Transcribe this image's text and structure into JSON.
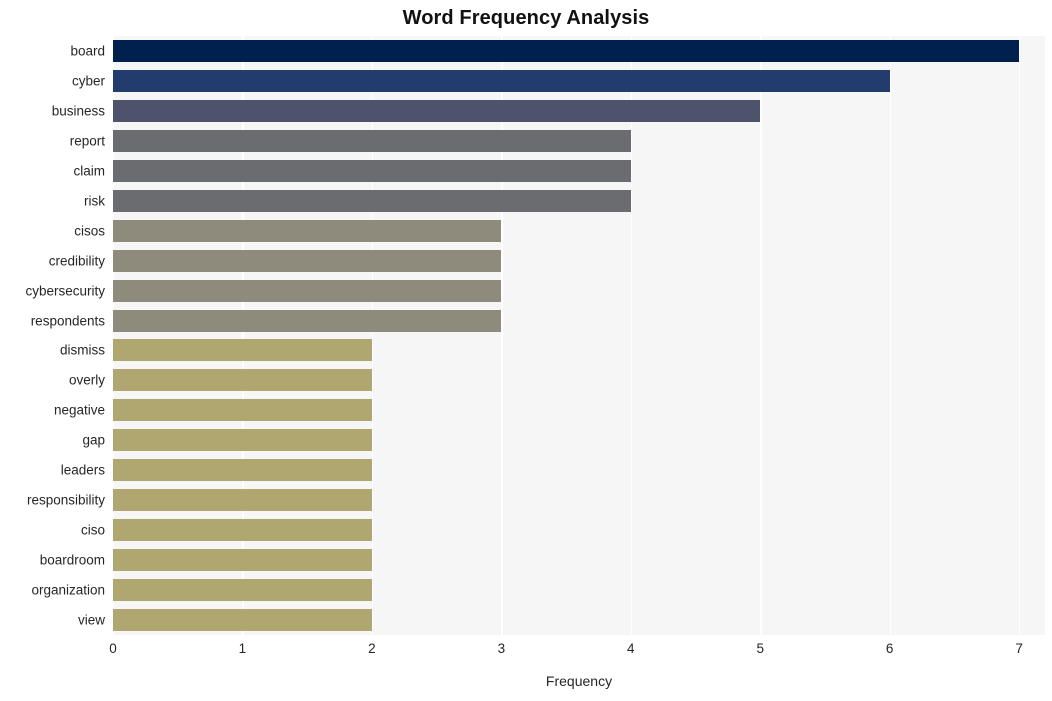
{
  "chart_data": {
    "type": "bar",
    "orientation": "horizontal",
    "title": "Word Frequency Analysis",
    "xlabel": "Frequency",
    "ylabel": "",
    "xlim": [
      0,
      7.2
    ],
    "xticks": [
      0,
      1,
      2,
      3,
      4,
      5,
      6,
      7
    ],
    "xtick_labels": [
      "0",
      "1",
      "2",
      "3",
      "4",
      "5",
      "6",
      "7"
    ],
    "grid": true,
    "grid_axis": "x",
    "legend": null,
    "categories": [
      "board",
      "cyber",
      "business",
      "report",
      "claim",
      "risk",
      "cisos",
      "credibility",
      "cybersecurity",
      "respondents",
      "dismiss",
      "overly",
      "negative",
      "gap",
      "leaders",
      "responsibility",
      "ciso",
      "boardroom",
      "organization",
      "view"
    ],
    "values": [
      7,
      6,
      5,
      4,
      4,
      4,
      3,
      3,
      3,
      3,
      2,
      2,
      2,
      2,
      2,
      2,
      2,
      2,
      2,
      2
    ],
    "bar_colors": [
      "#00214d",
      "#233c6e",
      "#4d536b",
      "#6b6c70",
      "#6b6c70",
      "#6b6c70",
      "#8e8b7c",
      "#8e8b7c",
      "#8e8b7c",
      "#8e8b7c",
      "#b0a66f",
      "#b0a66f",
      "#b0a66f",
      "#b0a66f",
      "#b0a66f",
      "#b0a66f",
      "#b0a66f",
      "#b0a66f",
      "#b0a66f",
      "#b0a66f"
    ]
  },
  "style": {
    "figure_background": "#ffffff",
    "plot_background": "#f6f6f7",
    "gridline_color": "#ffffff",
    "text_color": "#262626",
    "title_color": "#111111"
  }
}
